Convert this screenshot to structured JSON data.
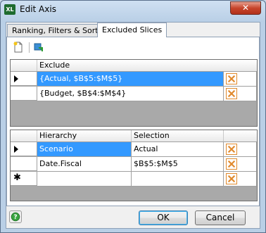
{
  "window": {
    "title": "Edit Axis",
    "app_icon_text": "XL",
    "close_glyph": "✕"
  },
  "tabs": [
    {
      "label": "Ranking, Filters & Sorting",
      "active": false
    },
    {
      "label": "Excluded Slices",
      "active": true
    }
  ],
  "toolbar": {
    "new_icon": "new-document-icon",
    "refresh_icon": "refresh-icon"
  },
  "exclude_grid": {
    "header": "Exclude",
    "rows": [
      {
        "value": "{Actual, $B$5:$M$5}",
        "selected": true,
        "current": true
      },
      {
        "value": "{Budget, $B$4:$M$4}",
        "selected": false,
        "current": false
      }
    ]
  },
  "hierarchy_grid": {
    "headers": [
      "Hierarchy",
      "Selection"
    ],
    "rows": [
      {
        "hierarchy": "Scenario",
        "selection": "Actual",
        "hierarchy_selected": true,
        "marker": "current"
      },
      {
        "hierarchy": "Date.Fiscal",
        "selection": "$B$5:$M$5",
        "hierarchy_selected": false,
        "marker": "none"
      },
      {
        "hierarchy": "",
        "selection": "",
        "hierarchy_selected": false,
        "marker": "new"
      }
    ]
  },
  "buttons": {
    "ok": "OK",
    "cancel": "Cancel"
  },
  "colors": {
    "selection": "#3399ff",
    "delete_accent": "#e08a2e",
    "close_button": "#c7452b"
  }
}
